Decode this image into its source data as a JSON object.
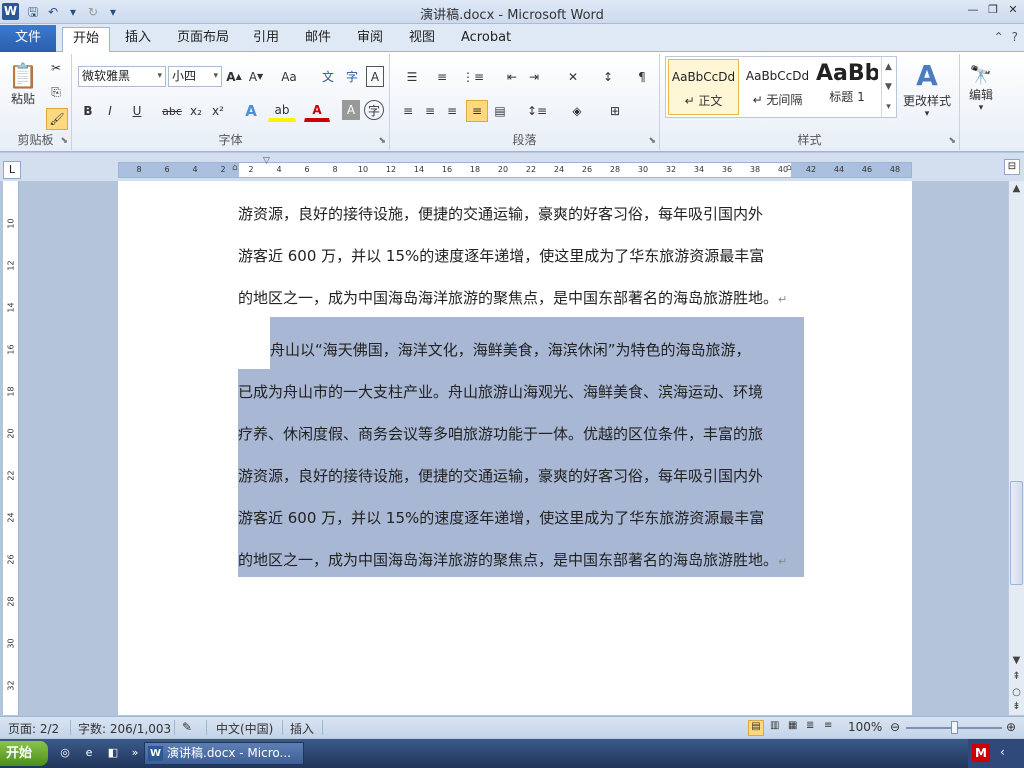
{
  "window": {
    "title": "演讲稿.docx - Microsoft Word",
    "app_icon": "W"
  },
  "ribbon_tabs": [
    "文件",
    "开始",
    "插入",
    "页面布局",
    "引用",
    "邮件",
    "审阅",
    "视图",
    "Acrobat"
  ],
  "ribbon": {
    "clipboard": {
      "paste": "粘贴",
      "label": "剪贴板"
    },
    "font": {
      "family": "微软雅黑",
      "size": "小四",
      "grow": "A",
      "shrink": "A",
      "case": "Aa",
      "bold": "B",
      "italic": "I",
      "underline": "U",
      "strike": "abc",
      "subscript": "x₂",
      "superscript": "x²",
      "label": "字体"
    },
    "paragraph": {
      "label": "段落"
    },
    "styles": {
      "items": [
        {
          "sample": "AaBbCcDd",
          "name": "↵ 正文"
        },
        {
          "sample": "AaBbCcDd",
          "name": "↵ 无间隔"
        },
        {
          "sample": "AaBb",
          "name": "标题 1"
        }
      ],
      "change": "更改样式",
      "label": "样式"
    },
    "editing": {
      "label": "编辑"
    }
  },
  "ruler_ticks": [
    "8",
    "6",
    "4",
    "2",
    "2",
    "4",
    "6",
    "8",
    "10",
    "12",
    "14",
    "16",
    "18",
    "20",
    "22",
    "24",
    "26",
    "28",
    "30",
    "32",
    "34",
    "36",
    "38",
    "40",
    "42",
    "44",
    "46",
    "48"
  ],
  "vruler_ticks": [
    "10",
    "12",
    "14",
    "16",
    "18",
    "20",
    "22",
    "24",
    "26",
    "28",
    "30",
    "32"
  ],
  "document": {
    "para1": [
      "游资源，良好的接待设施，便捷的交通运输，豪爽的好客习俗，每年吸引国内外",
      "游客近 600 万，并以 15%的速度逐年递增，使这里成为了华东旅游资源最丰富",
      "的地区之一，成为中国海岛海洋旅游的聚焦点，是中国东部著名的海岛旅游胜地。"
    ],
    "para2": [
      "舟山以“海天佛国，海洋文化，海鲜美食，海滨休闲”为特色的海岛旅游，",
      "已成为舟山市的一大支柱产业。舟山旅游山海观光、海鲜美食、滨海运动、环境",
      "疗养、休闲度假、商务会议等多咱旅游功能于一体。优越的区位条件，丰富的旅",
      "游资源，良好的接待设施，便捷的交通运输，豪爽的好客习俗，每年吸引国内外",
      "游客近 600 万，并以 15%的速度逐年递增，使这里成为了华东旅游资源最丰富",
      "的地区之一，成为中国海岛海洋旅游的聚焦点，是中国东部著名的海岛旅游胜地。"
    ],
    "para_mark": "↵"
  },
  "statusbar": {
    "page": "页面: 2/2",
    "words": "字数: 206/1,003",
    "language": "中文(中国)",
    "mode": "插入",
    "zoom": "100%"
  },
  "taskbar": {
    "start": "开始",
    "task": "演讲稿.docx - Micro..."
  }
}
